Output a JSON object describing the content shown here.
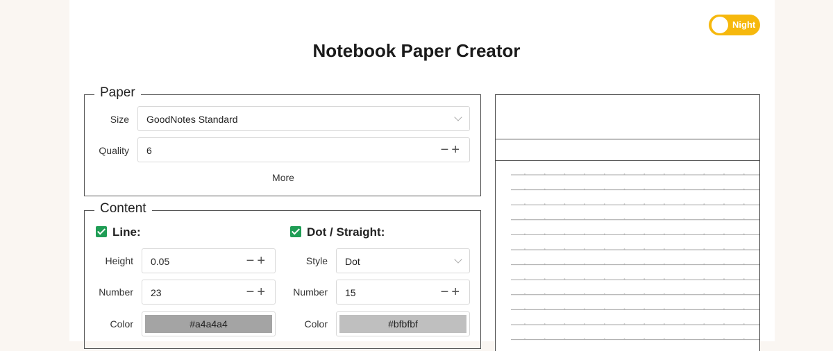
{
  "night_toggle": {
    "label": "Night"
  },
  "title": "Notebook Paper Creator",
  "paper": {
    "legend": "Paper",
    "size": {
      "label": "Size",
      "value": "GoodNotes Standard"
    },
    "quality": {
      "label": "Quality",
      "value": "6"
    },
    "more_label": "More"
  },
  "content": {
    "legend": "Content",
    "line": {
      "title": "Line:",
      "checked": true,
      "height": {
        "label": "Height",
        "value": "0.05"
      },
      "number": {
        "label": "Number",
        "value": "23"
      },
      "color": {
        "label": "Color",
        "value": "#a4a4a4"
      }
    },
    "dot": {
      "title": "Dot / Straight:",
      "checked": true,
      "style": {
        "label": "Style",
        "value": "Dot"
      },
      "number": {
        "label": "Number",
        "value": "15"
      },
      "color": {
        "label": "Color",
        "value": "#bfbfbf"
      }
    }
  },
  "stepper": {
    "minus": "−",
    "plus": "+"
  },
  "colors": {
    "toggle": "#f6b80d",
    "check": "#1f9d55",
    "line_color": "#a4a4a4",
    "dot_color": "#bfbfbf"
  }
}
